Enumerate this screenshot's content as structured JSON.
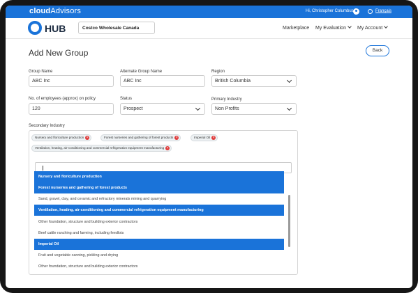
{
  "topbar": {
    "brand_a": "cloud",
    "brand_b": "Advisors",
    "greeting": "Hi, Christopher Columbus",
    "user_icon": "user-icon",
    "language_icon": "globe-icon",
    "language_link": "Français",
    "color": "#1a73d9"
  },
  "nav": {
    "logo": "HUB",
    "company": "Costco Wholesale Canada",
    "items": [
      {
        "label": "Marketplace"
      },
      {
        "label": "My Evaluation"
      },
      {
        "label": "My Account"
      }
    ]
  },
  "page": {
    "title": "Add New Group",
    "back_label": "Back"
  },
  "form": {
    "group_name": {
      "label": "Group Name",
      "value": "ABC Inc"
    },
    "alt_group_name": {
      "label": "Alternate Group Name",
      "value": "ABC Inc"
    },
    "region": {
      "label": "Region",
      "value": "British Columbia"
    },
    "employees": {
      "label": "No. of employees (approx) on policy",
      "value": "120"
    },
    "status": {
      "label": "Status",
      "value": "Prospect"
    },
    "primary_industry": {
      "label": "Primary Industry",
      "value": "Non Profits"
    },
    "secondary_industry": {
      "label": "Secondary Industry",
      "tags": [
        "Nursery and floriculture production",
        "Forest nurseries and gathering of forest products",
        "Imperial Oil",
        "Ventilation, heating, air-conditioning and commercial refrigeration equipment manufacturing"
      ],
      "search_value": "",
      "options": [
        {
          "label": "Nursery and floriculture production",
          "selected": true
        },
        {
          "label": "Forest nurseries and gathering of forest products",
          "selected": true
        },
        {
          "label": "Sand, gravel, clay, and ceramic and refractory minerals mining and quarrying",
          "selected": false
        },
        {
          "label": "Ventilation, heating, air-conditioning and commercial refrigeration equipment manufacturing",
          "selected": true
        },
        {
          "label": "Other foundation, structure and building exterior contractors",
          "selected": false
        },
        {
          "label": "Beef cattle ranching and farming, including feedlots",
          "selected": false
        },
        {
          "label": "Imperial Oil",
          "selected": true
        },
        {
          "label": "Fruit and vegetable canning, pickling and drying",
          "selected": false
        },
        {
          "label": "Other foundation, structure and building exterior contractors",
          "selected": false
        }
      ]
    }
  }
}
